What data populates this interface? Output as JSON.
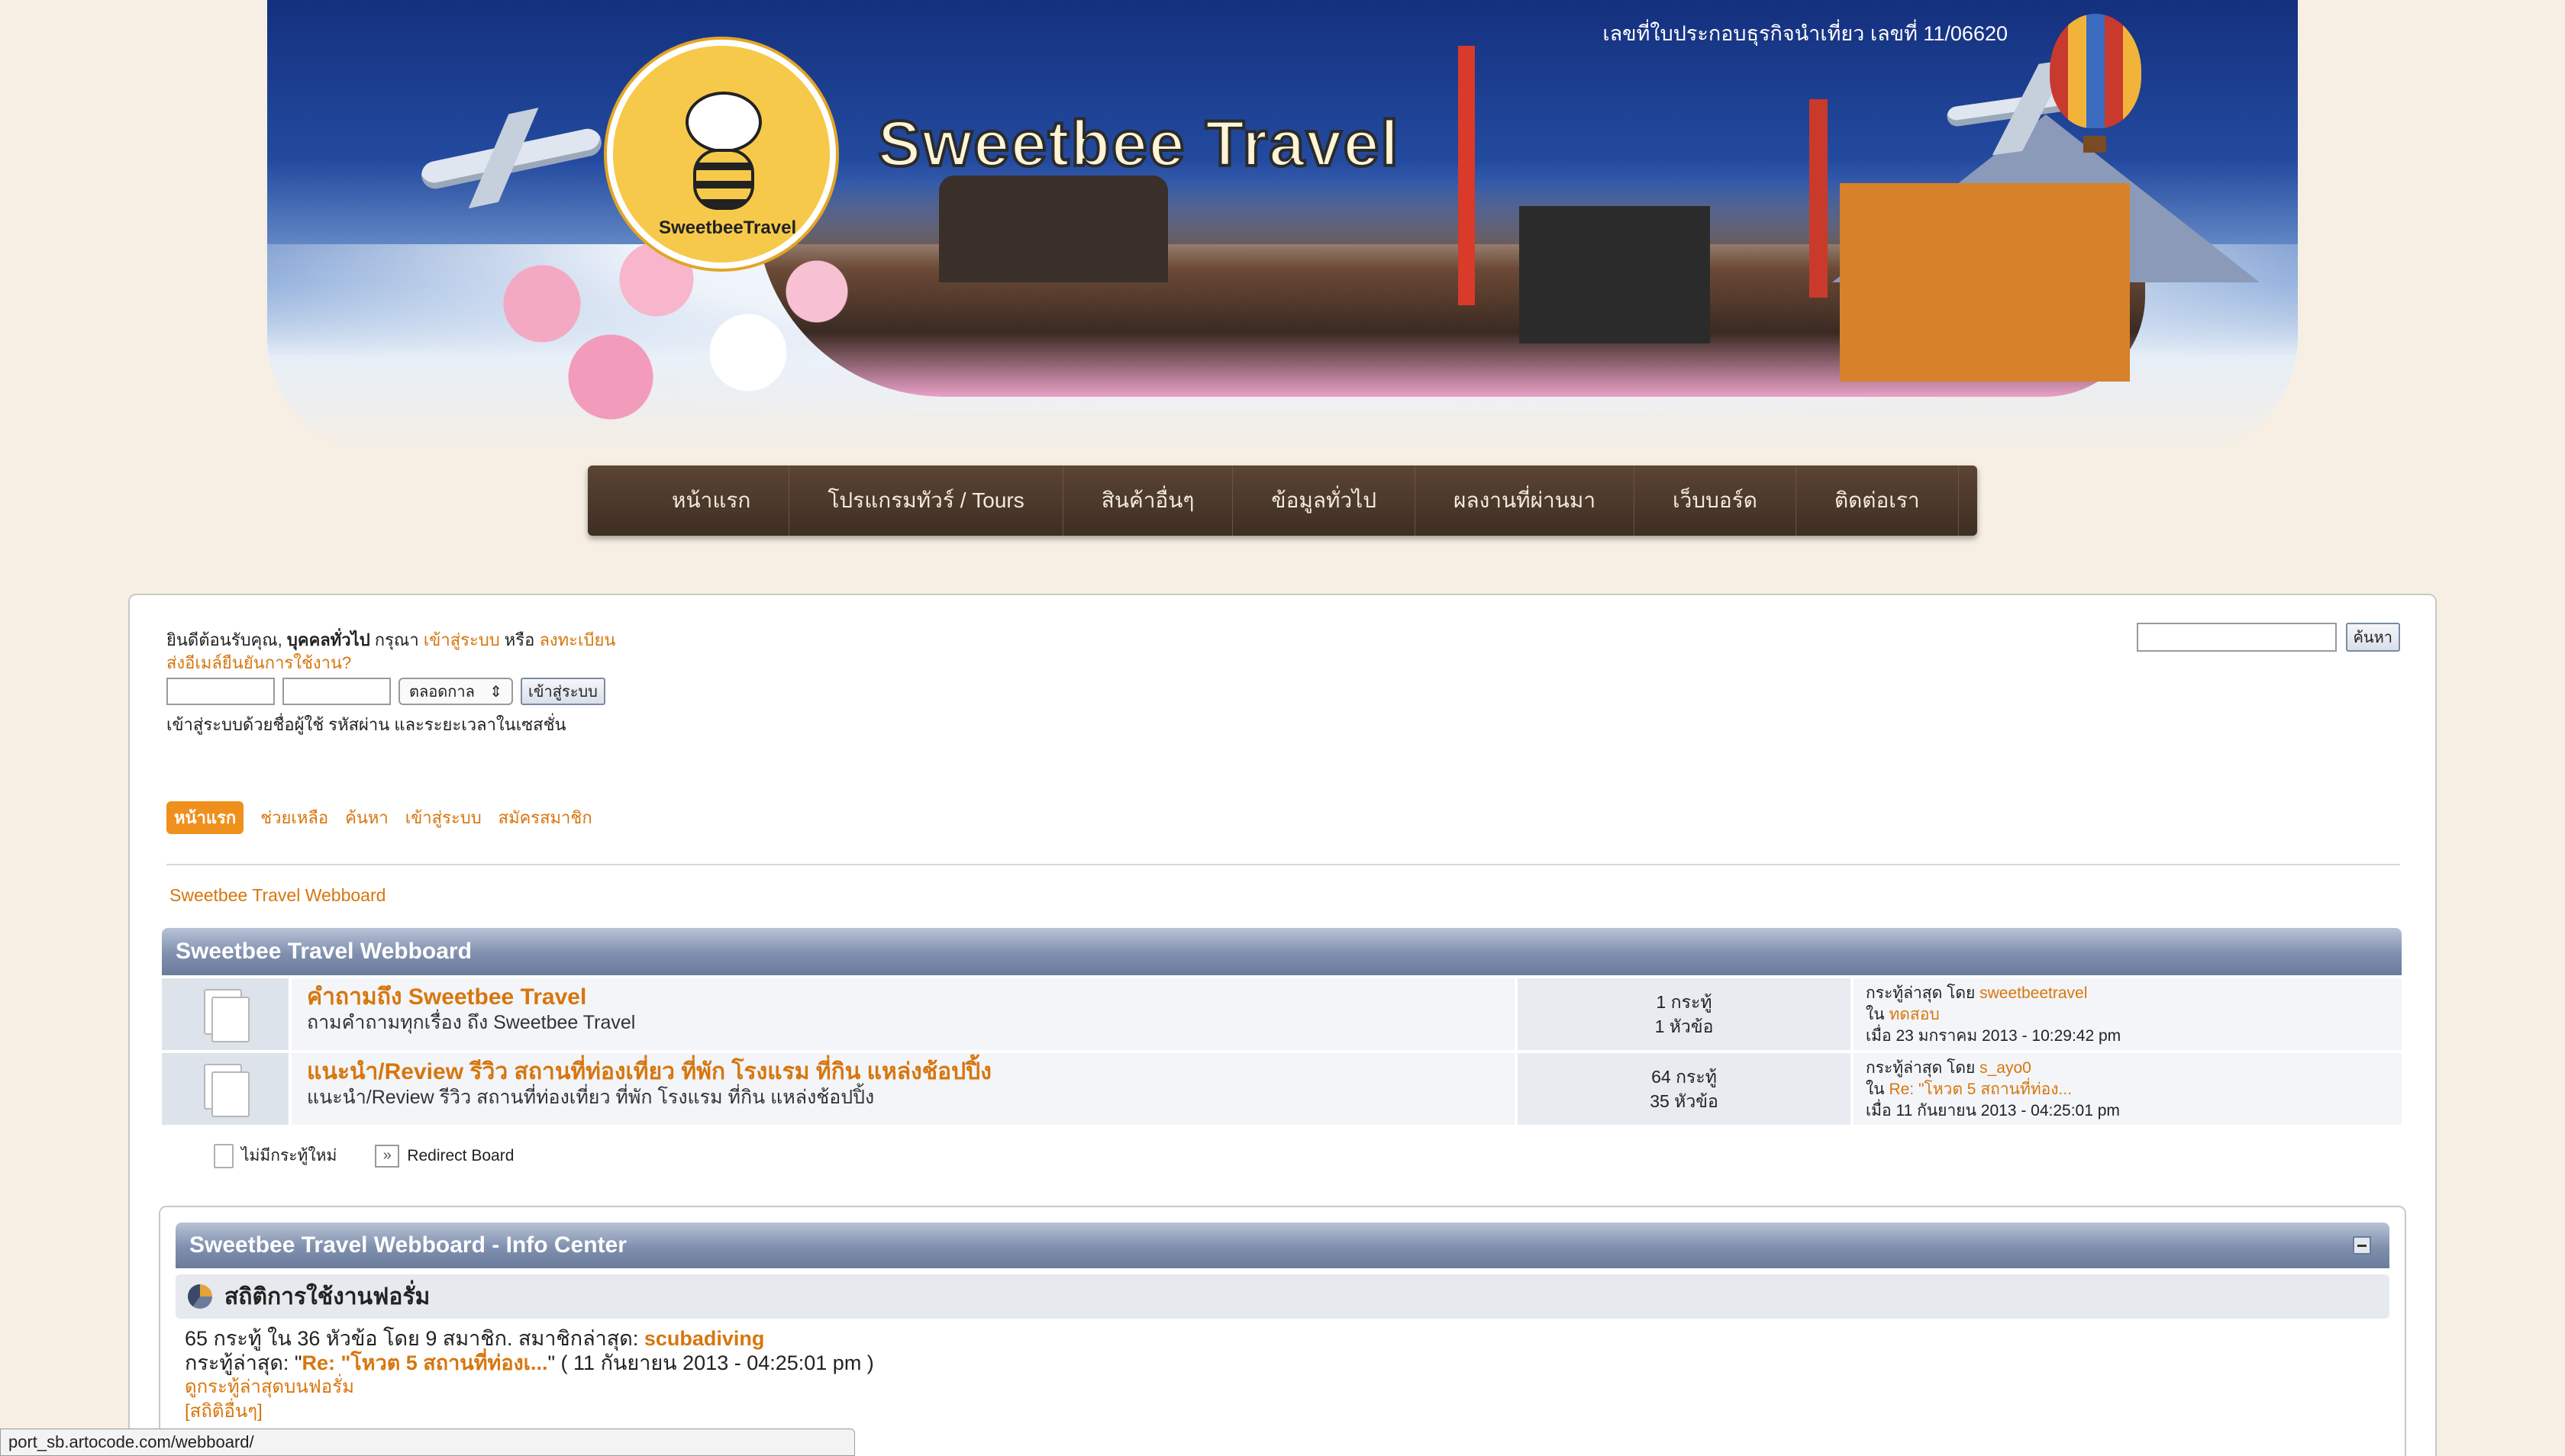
{
  "banner": {
    "license_text": "เลขที่ใบประกอบธุรกิจนำเที่ยว เลขที่ 11/06620",
    "brand": "Sweetbee Travel",
    "logo_text": "SweetbeeTravel"
  },
  "nav": {
    "items": [
      "หน้าแรก",
      "โปรแกรมทัวร์ / Tours",
      "สินค้าอื่นๆ",
      "ข้อมูลทั่วไป",
      "ผลงานที่ผ่านมา",
      "เว็บบอร์ด",
      "ติดต่อเรา"
    ]
  },
  "welcome": {
    "prefix": "ยินดีต้อนรับคุณ, ",
    "guest": "บุคคลทั่วไป",
    "please": " กรุณา ",
    "login_link": "เข้าสู่ระบบ",
    "or": " หรือ ",
    "register_link": "ลงทะเบียน",
    "resend_link": "ส่งอีเมล์ยืนยันการใช้งาน?"
  },
  "login": {
    "duration": "ตลอดกาล",
    "submit": "เข้าสู่ระบบ",
    "hint": "เข้าสู่ระบบด้วยชื่อผู้ใช้ รหัสผ่าน และระยะเวลาในเซสชั่น"
  },
  "search": {
    "button": "ค้นหา"
  },
  "subnav": {
    "tabs": [
      "หน้าแรก",
      "ช่วยเหลือ",
      "ค้นหา",
      "เข้าสู่ระบบ",
      "สมัครสมาชิก"
    ]
  },
  "breadcrumb": "Sweetbee Travel Webboard",
  "category": {
    "title": "Sweetbee Travel Webboard",
    "boards": [
      {
        "title": "คำถามถึง Sweetbee Travel",
        "desc": "ถามคำถามทุกเรื่อง ถึง Sweetbee Travel",
        "posts": "1 กระทู้",
        "topics": "1 หัวข้อ",
        "last_label": "กระทู้ล่าสุด โดย ",
        "last_user": "sweetbeetravel",
        "in_label": "ใน ",
        "last_topic": "ทดสอบ",
        "last_date": "เมื่อ 23 มกราคม 2013 - 10:29:42 pm"
      },
      {
        "title": "แนะนำ/Review รีวิว สถานที่ท่องเที่ยว ที่พัก โรงแรม ที่กิน แหล่งช้อปปิ้ง",
        "desc": "แนะนำ/Review รีวิว สถานที่ท่องเที่ยว ที่พัก โรงแรม ที่กิน แหล่งช้อปปิ้ง",
        "posts": "64 กระทู้",
        "topics": "35 หัวข้อ",
        "last_label": "กระทู้ล่าสุด โดย ",
        "last_user": "s_ayo0",
        "in_label": "ใน ",
        "last_topic": "Re: \"โหวต 5 สถานที่ท่อง...",
        "last_date": "เมื่อ 11 กันยายน 2013 - 04:25:01 pm"
      }
    ]
  },
  "legend": {
    "no_new": "ไม่มีกระทู้ใหม่",
    "redirect": "Redirect Board"
  },
  "info_center": {
    "title": "Sweetbee Travel Webboard - Info Center",
    "stats_title": "สถิติการใช้งานฟอรั่ม",
    "line1_prefix": "65 กระทู้ ใน 36 หัวข้อ โดย 9 สมาชิก. สมาชิกล่าสุด: ",
    "line1_user": "scubadiving",
    "line2_prefix": "กระทู้ล่าสุด: \"",
    "line2_link": "Re: \"โหวต 5 สถานที่ท่องเ...",
    "line2_suffix": "\" ( 11 กันยายน 2013 - 04:25:01 pm )",
    "recent_link": "ดูกระทู้ล่าสุดบนฟอรั่ม",
    "more_link": "[สถิติอื่นๆ]"
  },
  "status_bar": "port_sb.artocode.com/webboard/",
  "colors": {
    "accent": "#d7760e",
    "nav_bg": "#4a3829",
    "header_bar": "#7f8fae",
    "page_bg": "#f7efe3"
  }
}
